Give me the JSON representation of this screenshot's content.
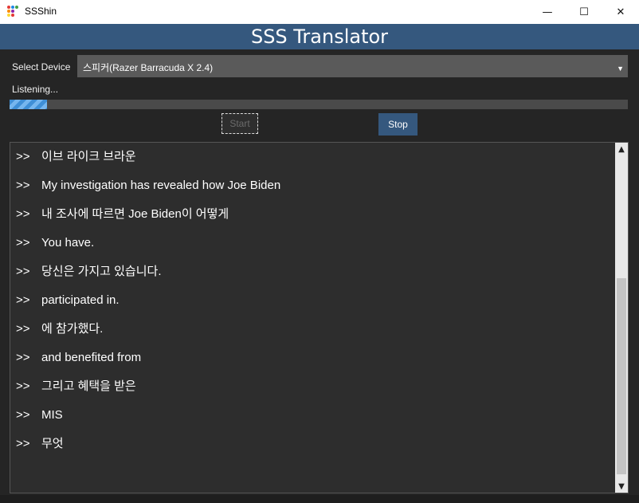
{
  "window": {
    "title": "SSShin",
    "controls": {
      "minimize": "—",
      "maximize": "☐",
      "close": "✕"
    }
  },
  "header": {
    "title": "SSS Translator",
    "background": "#35587e"
  },
  "device": {
    "label": "Select Device",
    "selected": "스피커(Razer Barracuda X 2.4)"
  },
  "status": {
    "text": "Listening...",
    "progress": 0.06
  },
  "buttons": {
    "start": "Start",
    "stop": "Stop"
  },
  "log": {
    "prefix": ">>",
    "entries": [
      "이브 라이크 브라운",
      "My investigation has revealed how Joe Biden",
      "내 조사에 따르면 Joe Biden이 어떻게",
      "You have.",
      "당신은 가지고 있습니다.",
      "participated in.",
      "에 참가했다.",
      "and benefited from",
      "그리고 혜택을 받은",
      "MIS",
      "무엇"
    ]
  },
  "icons": {
    "app": "app-logo-icon",
    "dropdown": "chevron-down-icon",
    "scroll_up": "scroll-up-icon",
    "scroll_down": "scroll-down-icon"
  }
}
